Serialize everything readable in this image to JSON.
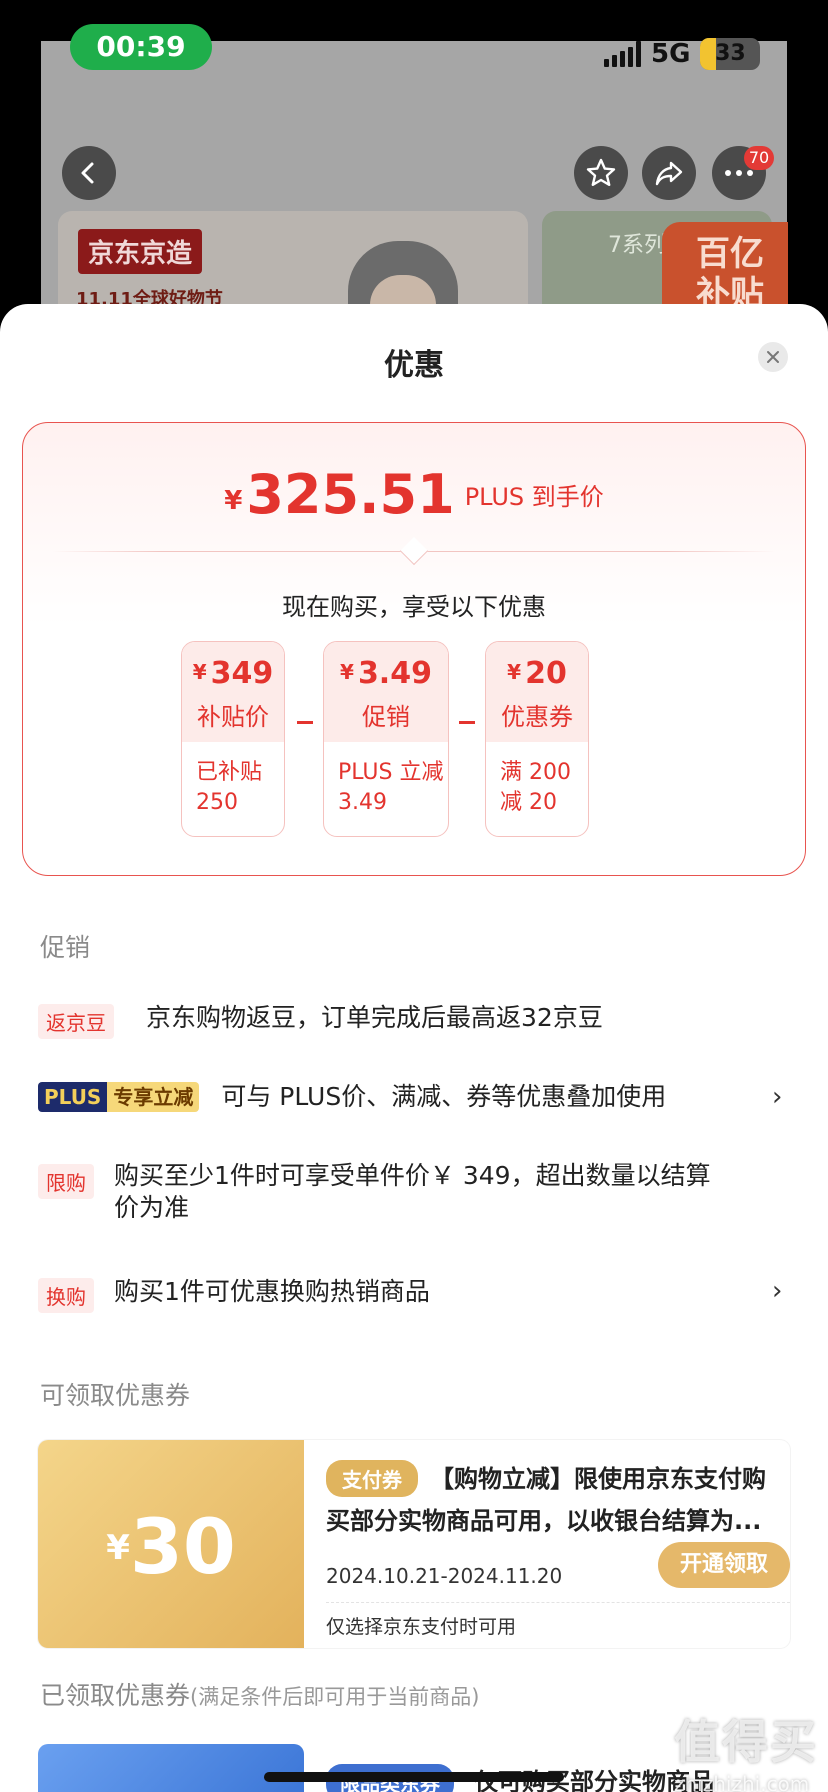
{
  "status_bar": {
    "time": "00:39",
    "network": "5G",
    "battery": "33"
  },
  "nav": {
    "notification_count": "70"
  },
  "background": {
    "brand_label": "京东京造",
    "festival_label": "11.11全球好物节",
    "series_label": "7系列",
    "subsidy_badge": "百亿补贴"
  },
  "sheet": {
    "title": "优惠",
    "price": {
      "currency": "¥",
      "amount": "325.51",
      "tag": "PLUS 到手价",
      "enjoy_text": "现在购买，享受以下优惠"
    },
    "price_cards": [
      {
        "currency": "¥",
        "value": "349",
        "label": "补贴价",
        "desc_line1": "已补贴",
        "desc_line2": "250"
      },
      {
        "currency": "¥",
        "value": "3.49",
        "label": "促销",
        "desc_line1": "PLUS 立减",
        "desc_line2": "3.49"
      },
      {
        "currency": "¥",
        "value": "20",
        "label": "优惠券",
        "desc_line1": "满 200",
        "desc_line2": "减 20"
      }
    ],
    "promotions": {
      "heading": "促销",
      "items": [
        {
          "tag": "返京豆",
          "text": "京东购物返豆，订单完成后最高返32京豆"
        },
        {
          "tag_a": "PLUS",
          "tag_b": "专享立减",
          "text": "可与 PLUS价、满减、券等优惠叠加使用",
          "chevron": "›"
        },
        {
          "tag": "限购",
          "text": "购买至少1件时可享受单件价￥ 349，超出数量以结算价为准"
        },
        {
          "tag": "换购",
          "text": "购买1件可优惠换购热销商品",
          "chevron": "›"
        }
      ]
    },
    "available_coupons": {
      "heading": "可领取优惠券",
      "coupon": {
        "currency": "¥",
        "amount": "30",
        "badge": "支付券",
        "title": "【购物立减】限使用京东支付购买部分实物商品可用，以收银台结算为...",
        "date_range": "2024.10.21-2024.11.20",
        "button": "开通领取",
        "note": "仅选择京东支付时可用"
      }
    },
    "claimed_coupons": {
      "heading": "已领取优惠券",
      "subheading": "(满足条件后即可用于当前商品)",
      "badge": "限品类东券",
      "title": "仅可购买部分实物商品"
    }
  },
  "watermark": {
    "text": "值得买",
    "site": "zhizhizhi.com"
  },
  "colors": {
    "accent_red": "#e3342e",
    "coupon_gold": "#e0b45e",
    "coupon_blue": "#3e6fd0",
    "plus_navy": "#1d2b6b"
  },
  "icons": [
    "back-icon",
    "star-icon",
    "share-icon",
    "more-icon",
    "close-icon",
    "chevron-right-icon"
  ]
}
